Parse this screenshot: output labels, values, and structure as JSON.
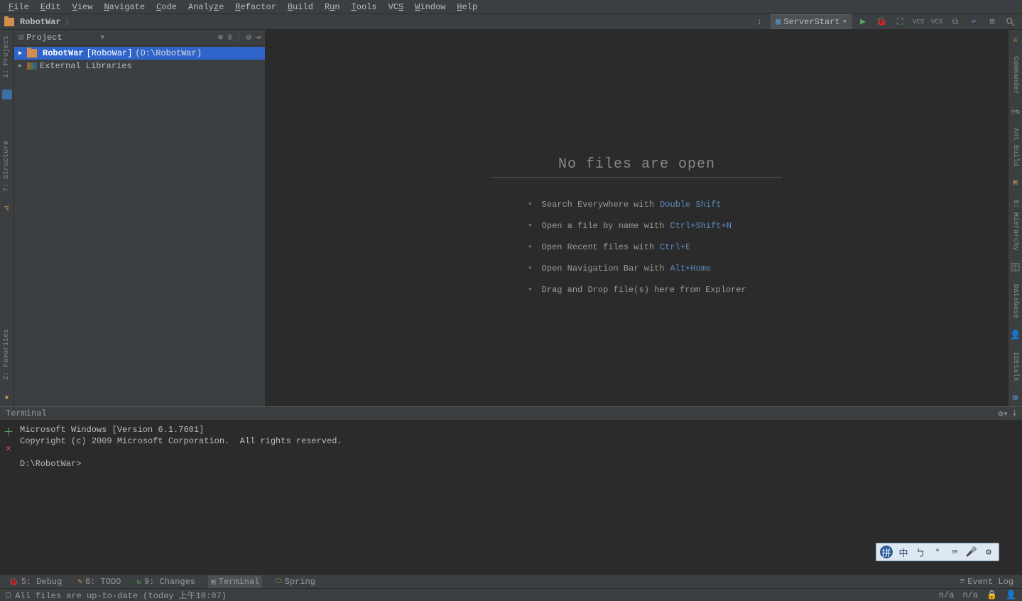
{
  "menubar": [
    "File",
    "Edit",
    "View",
    "Navigate",
    "Code",
    "Analyze",
    "Refactor",
    "Build",
    "Run",
    "Tools",
    "VCS",
    "Window",
    "Help"
  ],
  "breadcrumb": {
    "project": "RobotWar"
  },
  "toolbar": {
    "run_config": "ServerStart",
    "vcs1": "VCS",
    "vcs2": "VCS"
  },
  "project_panel": {
    "title": "Project",
    "root": {
      "name": "RobotWar",
      "module": "[RoboWar]",
      "path": "(D:\\RobotWar)"
    },
    "external_libs": "External Libraries"
  },
  "left_rail": {
    "project": "1: Project",
    "structure": "7: Structure",
    "favorites": "2: Favorites"
  },
  "right_rail": {
    "commander": "Commander",
    "antbuild": "Ant Build",
    "hierarchy": "8: Hierarchy",
    "database": "Database",
    "idetalk": "IDEtalk",
    "maven": "Maven Projects"
  },
  "editor": {
    "title": "No files are open",
    "tips": [
      {
        "text": "Search Everywhere with",
        "kbd": "Double Shift"
      },
      {
        "text": "Open a file by name with",
        "kbd": "Ctrl+Shift+N"
      },
      {
        "text": "Open Recent files with",
        "kbd": "Ctrl+E"
      },
      {
        "text": "Open Navigation Bar with",
        "kbd": "Alt+Home"
      },
      {
        "text": "Drag and Drop file(s) here from Explorer",
        "kbd": ""
      }
    ]
  },
  "terminal": {
    "title": "Terminal",
    "line1": "Microsoft Windows [Version 6.1.7601]",
    "line2": "Copyright (c) 2009 Microsoft Corporation.  All rights reserved.",
    "prompt": "D:\\RobotWar>"
  },
  "bottom_tabs": {
    "debug": "5: Debug",
    "todo": "6: TODO",
    "changes": "9: Changes",
    "terminal": "Terminal",
    "spring": "Spring",
    "eventlog": "Event Log"
  },
  "statusbar": {
    "msg": "All files are up-to-date (today 上午10:07)",
    "na1": "n/a",
    "na2": "n/a"
  },
  "ime": [
    "中",
    "ㄅ",
    "°",
    "⌨",
    "🎤",
    "⚙"
  ]
}
